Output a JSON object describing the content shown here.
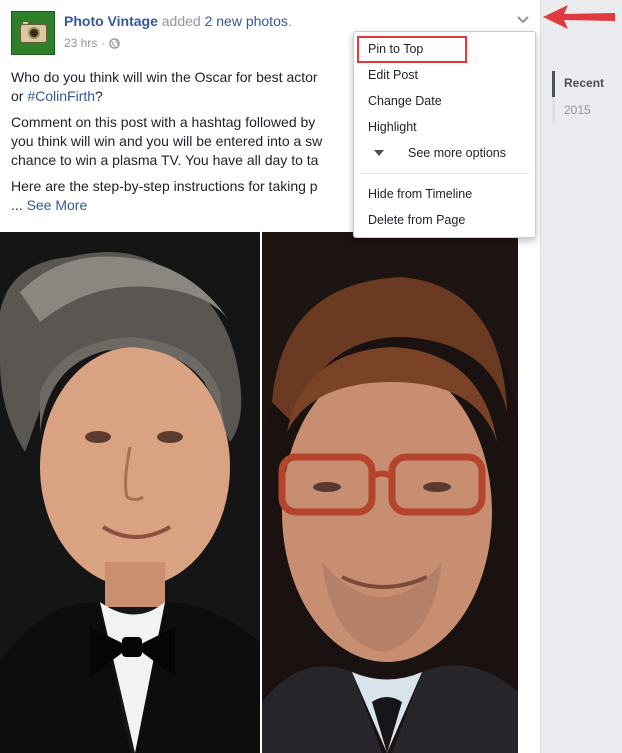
{
  "post": {
    "page_name": "Photo Vintage",
    "action_text": " added ",
    "action_link": "2 new photos",
    "action_end": ".",
    "time": "23 hrs",
    "meta_separator": "·",
    "text": {
      "line1": "Who do you think will win the Oscar for best actor",
      "line2_prefix": "or ",
      "hashtag": "#ColinFirth",
      "line2_suffix": "?",
      "line3": "Comment on this post with a hashtag followed by",
      "line4": "you think will win and you will be entered into a sw",
      "line5": "chance to win a plasma TV. You have all day to ta",
      "line6": "Here are the step-by-step instructions for taking p",
      "ellipsis": "... ",
      "see_more": "See More"
    },
    "photos": [
      {
        "icon": "portrait-man-tuxedo"
      },
      {
        "icon": "portrait-man-glasses"
      }
    ]
  },
  "dropdown": {
    "items": [
      "Pin to Top",
      "Edit Post",
      "Change Date",
      "Highlight",
      "See more options",
      "Hide from Timeline",
      "Delete from Page"
    ],
    "highlighted": "Pin to Top",
    "highlight_color": "#e0393e"
  },
  "timeline_nav": {
    "items": [
      "Recent",
      "2015"
    ]
  },
  "colors": {
    "link": "#365899",
    "muted": "#90949c",
    "annotation": "#e0393e"
  }
}
